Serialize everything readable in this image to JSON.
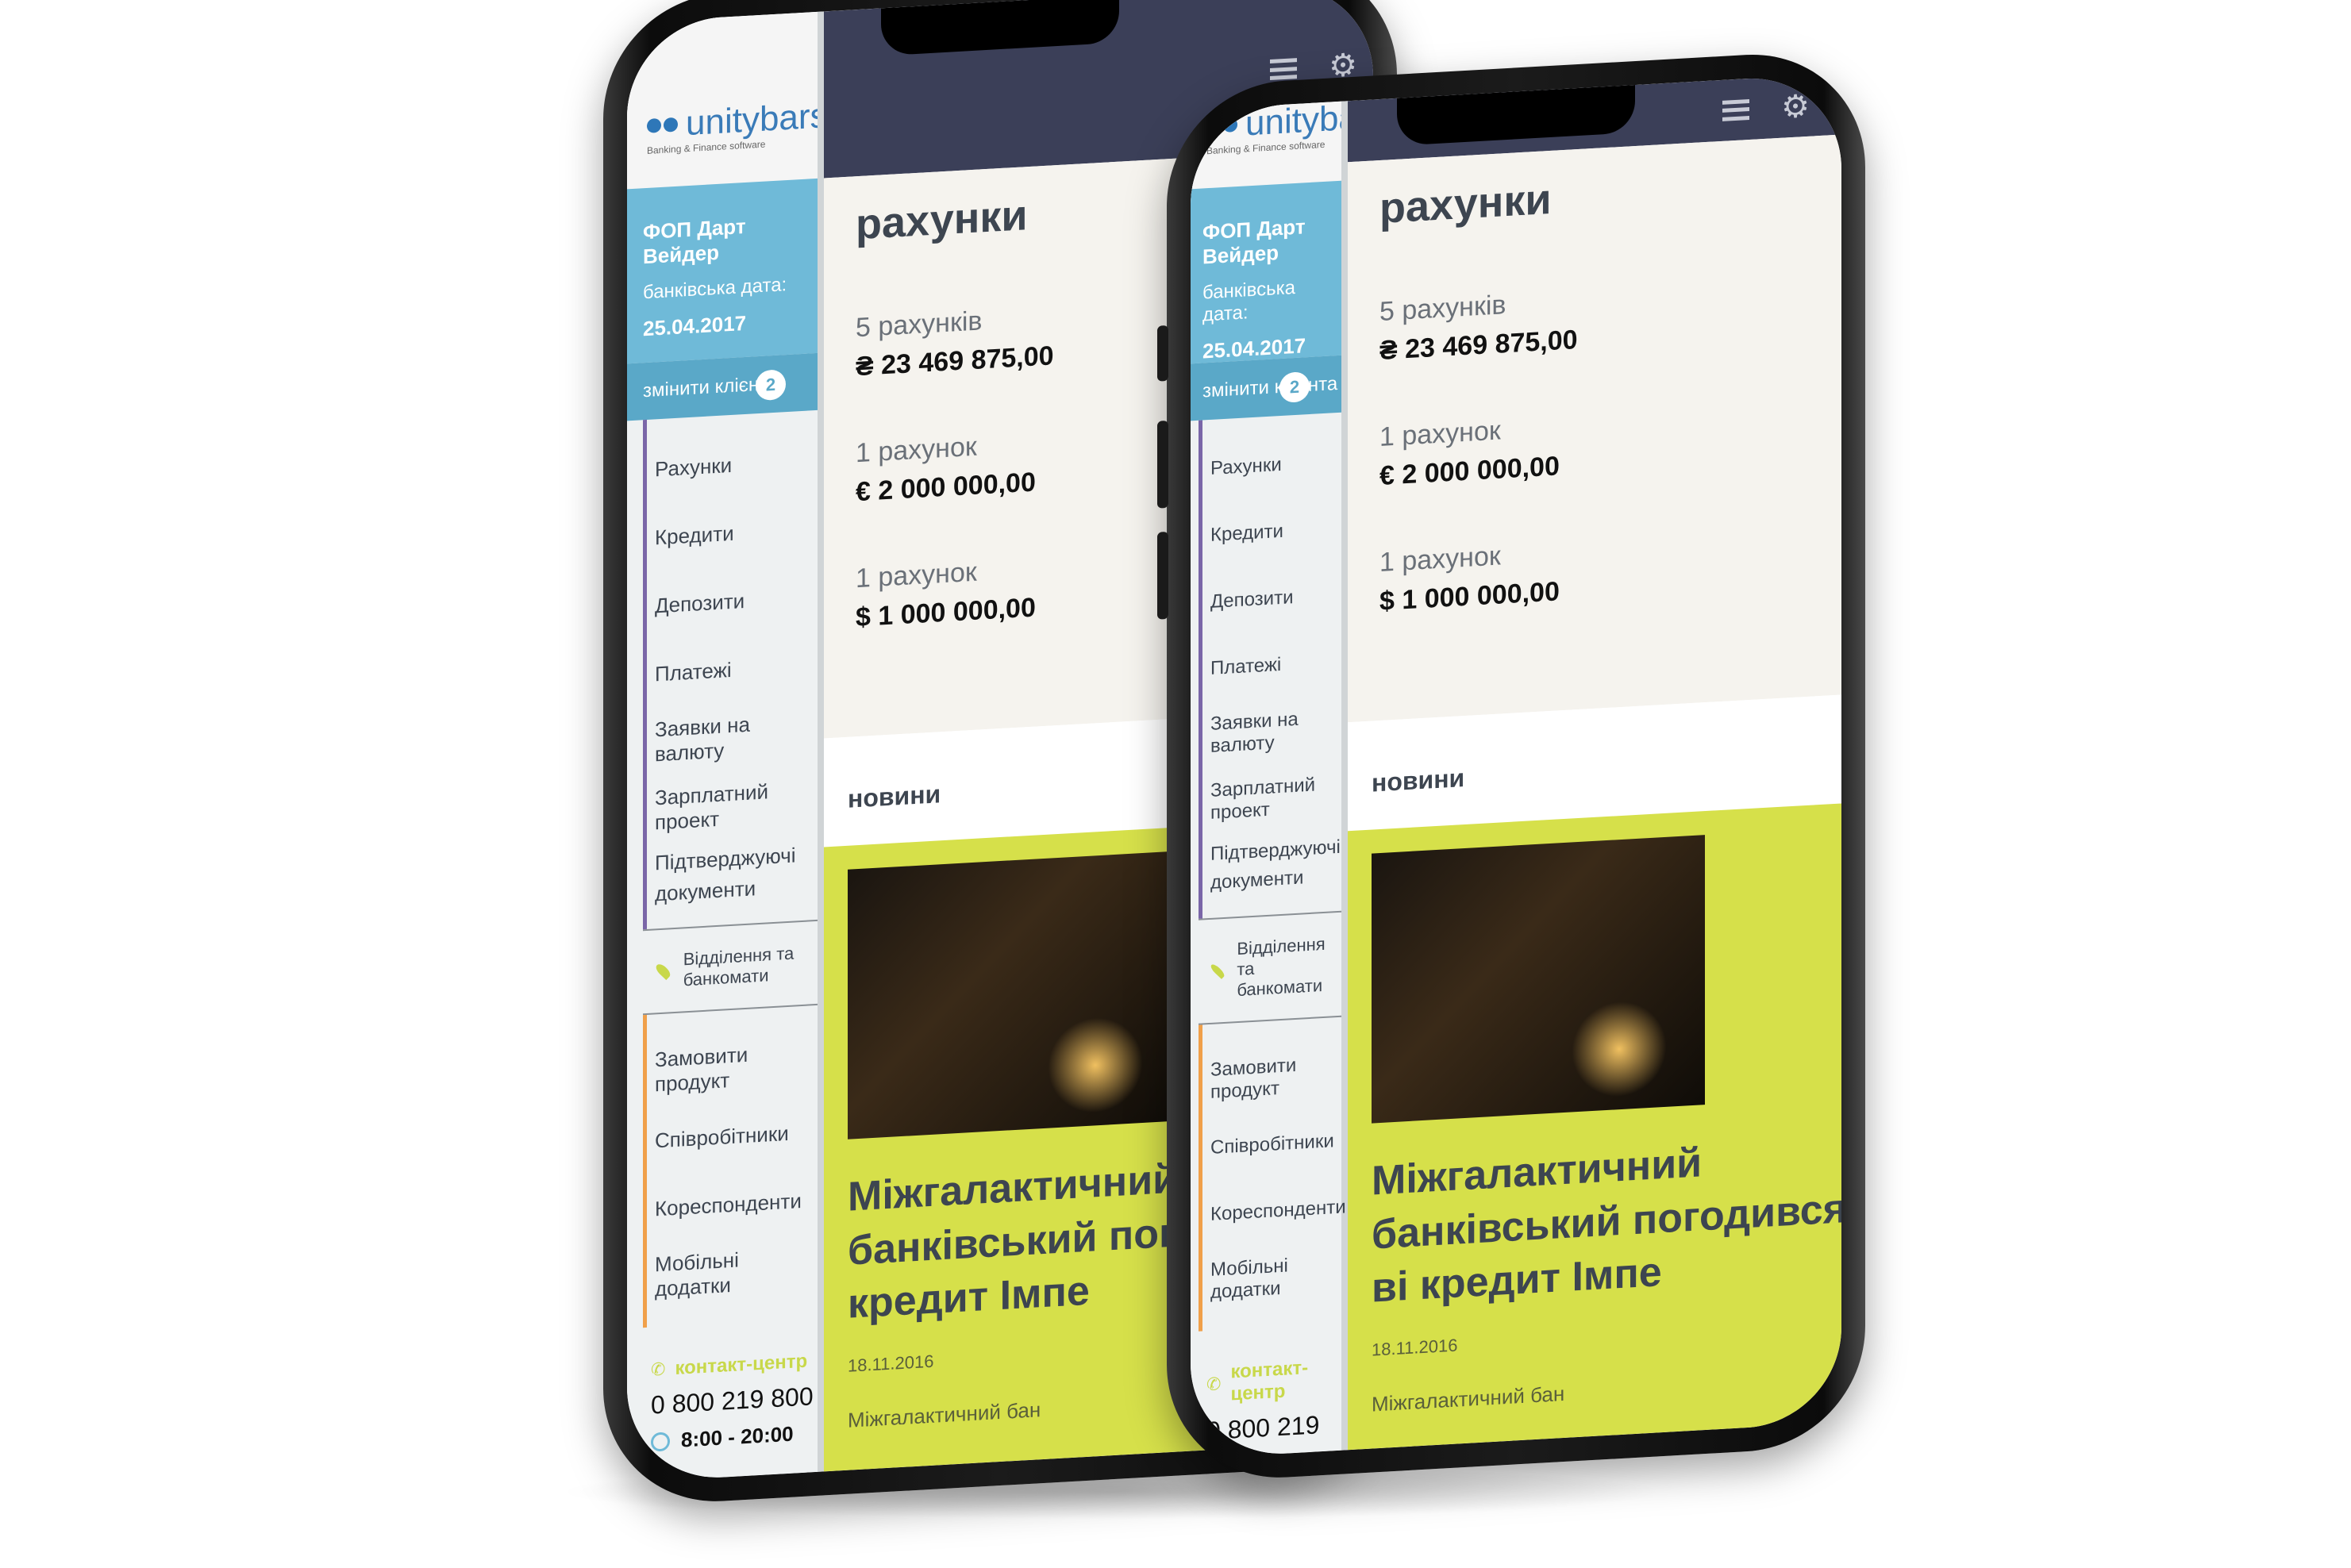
{
  "app": {
    "logo_text": "unitybars",
    "logo_subtitle": "Banking & Finance software"
  },
  "client": {
    "name": "ФОП Дарт Вейдер",
    "date_label": "банківська дата:",
    "date": "25.04.2017",
    "change_label": "змінити клієнта",
    "badge_count": "2"
  },
  "nav": {
    "items": [
      "Рахунки",
      "Кредити",
      "Депозити",
      "Платежі",
      "Заявки на валюту",
      "Зарплатний проект",
      "Підтверджуючі документи"
    ],
    "branch_label": "Відділення та банкомати",
    "secondary": [
      "Замовити продукт",
      "Співробітники",
      "Кореспонденти",
      "Мобільні додатки"
    ]
  },
  "contact": {
    "label": "контакт-центр",
    "phone": "0 800 219 800",
    "hours": "8:00 - 20:00"
  },
  "accounts": {
    "title": "рахунки",
    "list": [
      {
        "count": "5 рахунків",
        "sum": "₴ 23 469 875,00"
      },
      {
        "count": "1 рахунок",
        "sum": "€ 2 000 000,00"
      },
      {
        "count": "1 рахунок",
        "sum": "$ 1 000 000,00"
      }
    ]
  },
  "news": {
    "heading": "новини",
    "title": "Міжгалактичний банківський погодився ві кредит Імпе",
    "date": "18.11.2016",
    "excerpt": "Міжгалактичний бан"
  },
  "colors": {
    "header_dark": "#3b3f58",
    "client_blue": "#6fbad8",
    "news_yellow": "#d6e04a",
    "accent_purple": "#7a66a8",
    "accent_orange": "#f0a04a"
  }
}
